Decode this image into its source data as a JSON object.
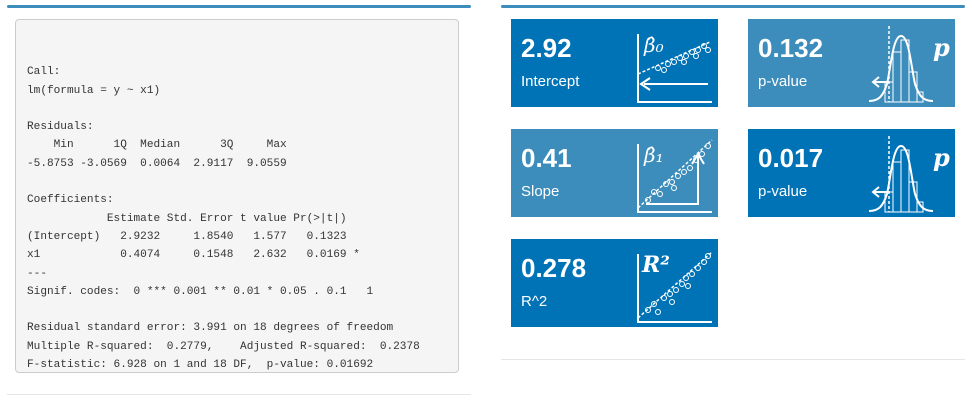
{
  "left_panel": {
    "lines": [
      "",
      "Call:",
      "lm(formula = y ~ x1)",
      "",
      "Residuals:",
      "    Min      1Q  Median      3Q     Max ",
      "-5.8753 -3.0569  0.0064  2.9117  9.0559 ",
      "",
      "Coefficients:",
      "            Estimate Std. Error t value Pr(>|t|)  ",
      "(Intercept)   2.9232     1.8540   1.577   0.1323  ",
      "x1            0.4074     0.1548   2.632   0.0169 *",
      "---",
      "Signif. codes:  0 *** 0.001 ** 0.01 * 0.05 . 0.1   1",
      "",
      "Residual standard error: 3.991 on 18 degrees of freedom",
      "Multiple R-squared:  0.2779,\tAdjusted R-squared:  0.2378 ",
      "F-statistic: 6.928 on 1 and 18 DF,  p-value: 0.01692"
    ]
  },
  "colors": {
    "dark_box": "#0073b7",
    "light_box": "#3c8dbc",
    "panel_accent": "#3c8dbc"
  },
  "value_boxes": {
    "intercept": {
      "value": "2.92",
      "label": "Intercept",
      "icon": "beta0-intercept-icon",
      "icon_text": "β̂₀"
    },
    "intercept_p": {
      "value": "0.132",
      "label": "p-value",
      "icon": "pvalue-distribution-icon",
      "icon_text": "p"
    },
    "slope": {
      "value": "0.41",
      "label": "Slope",
      "icon": "beta1-slope-icon",
      "icon_text": "β̂₁"
    },
    "slope_p": {
      "value": "0.017",
      "label": "p-value",
      "icon": "pvalue-distribution-icon",
      "icon_text": "p"
    },
    "r2": {
      "value": "0.278",
      "label": "R^2",
      "icon": "r-squared-icon",
      "icon_text": "R²"
    }
  }
}
